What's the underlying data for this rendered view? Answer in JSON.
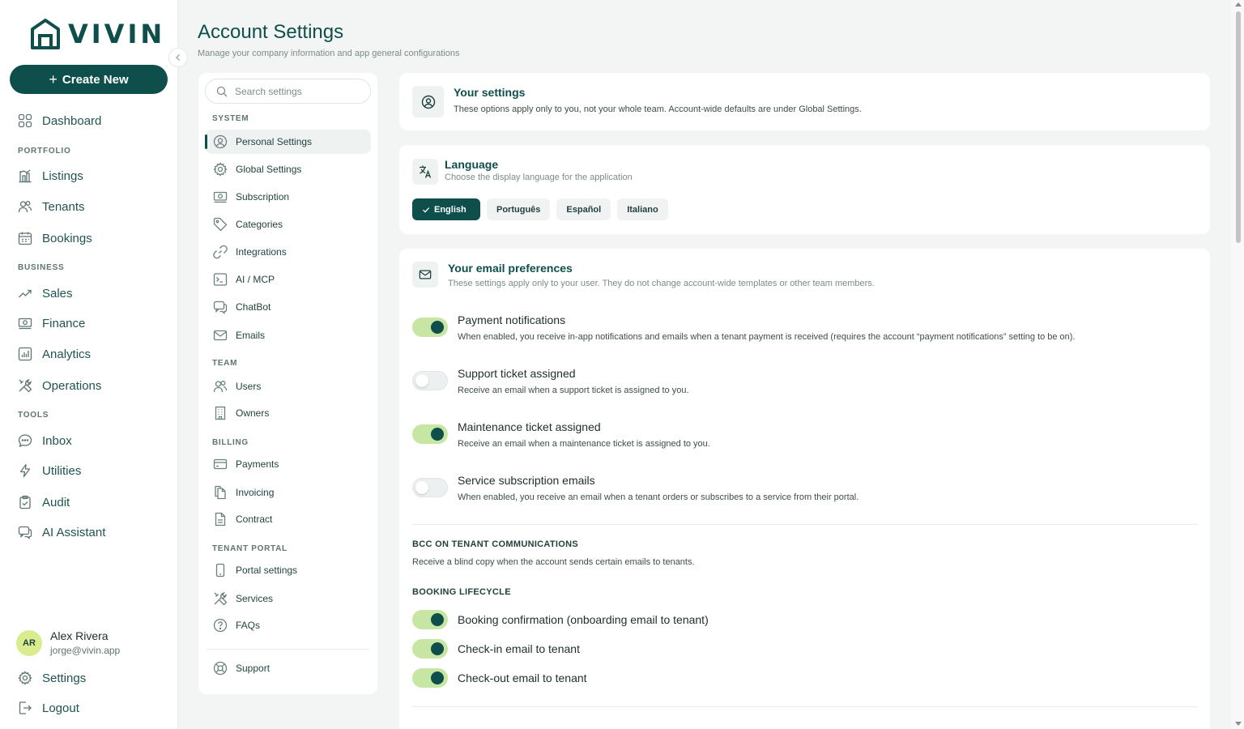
{
  "brand": {
    "name": "VIVIN",
    "accent": "#0e4f4c",
    "toggle_on": "#c8e6a3"
  },
  "nav": {
    "create_label": "Create New",
    "dashboard": "Dashboard",
    "sections": {
      "portfolio": "PORTFOLIO",
      "business": "BUSINESS",
      "tools": "TOOLS"
    },
    "listings": "Listings",
    "tenants": "Tenants",
    "bookings": "Bookings",
    "sales": "Sales",
    "finance": "Finance",
    "analytics": "Analytics",
    "operations": "Operations",
    "inbox": "Inbox",
    "utilities": "Utilities",
    "audit": "Audit",
    "ai_assistant": "AI Assistant",
    "settings": "Settings",
    "logout": "Logout"
  },
  "user": {
    "initials": "AR",
    "name": "Alex Rivera",
    "email": "jorge@vivin.app"
  },
  "header": {
    "title": "Account Settings",
    "subtitle": "Manage your company information and app general configurations"
  },
  "menu": {
    "search_placeholder": "Search settings",
    "sections": {
      "system": "SYSTEM",
      "team": "TEAM",
      "billing": "BILLING",
      "tenant_portal": "TENANT PORTAL"
    },
    "personal": "Personal Settings",
    "global": "Global Settings",
    "subscription": "Subscription",
    "categories": "Categories",
    "integrations": "Integrations",
    "ai_mcp": "AI / MCP",
    "chatbot": "ChatBot",
    "emails": "Emails",
    "users": "Users",
    "owners": "Owners",
    "payments": "Payments",
    "invoicing": "Invoicing",
    "contract": "Contract",
    "portal_settings": "Portal settings",
    "services": "Services",
    "faqs": "FAQs",
    "support": "Support"
  },
  "your_settings": {
    "title": "Your settings",
    "desc": "These options apply only to you, not your whole team. Account-wide defaults are under Global Settings."
  },
  "language": {
    "title": "Language",
    "desc": "Choose the display language for the application",
    "options": [
      "English",
      "Português",
      "Español",
      "Italiano"
    ],
    "selected": "English"
  },
  "email_prefs": {
    "title": "Your email preferences",
    "desc": "These settings apply only to your user. They do not change account-wide templates or other team members.",
    "items": [
      {
        "title": "Payment notifications",
        "desc": "When enabled, you receive in-app notifications and emails when a tenant payment is received (requires the account “payment notifications” setting to be on).",
        "on": true
      },
      {
        "title": "Support ticket assigned",
        "desc": "Receive an email when a support ticket is assigned to you.",
        "on": false
      },
      {
        "title": "Maintenance ticket assigned",
        "desc": "Receive an email when a maintenance ticket is assigned to you.",
        "on": true
      },
      {
        "title": "Service subscription emails",
        "desc": "When enabled, you receive an email when a tenant orders or subscribes to a service from their portal.",
        "on": false
      }
    ],
    "bcc_title": "BCC ON TENANT COMMUNICATIONS",
    "bcc_desc": "Receive a blind copy when the account sends certain emails to tenants.",
    "booking_title": "BOOKING LIFECYCLE",
    "booking_items": [
      {
        "title": "Booking confirmation (onboarding email to tenant)",
        "on": true
      },
      {
        "title": "Check-in email to tenant",
        "on": true
      },
      {
        "title": "Check-out email to tenant",
        "on": true
      }
    ]
  }
}
